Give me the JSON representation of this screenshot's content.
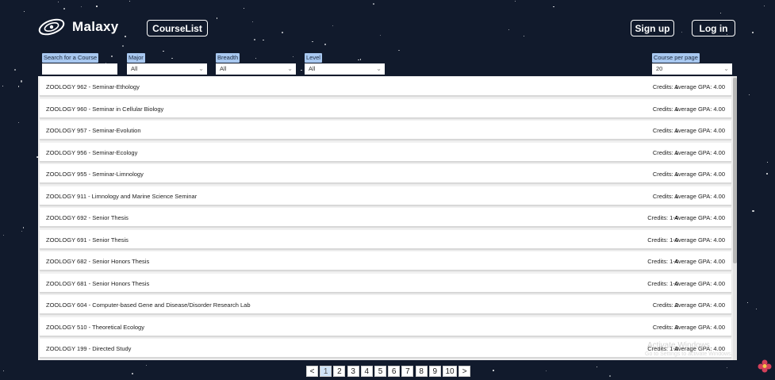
{
  "app": {
    "name": "Malaxy"
  },
  "nav": {
    "courselist_label": "CourseList",
    "signup_label": "Sign up",
    "login_label": "Log in"
  },
  "filters": {
    "search": {
      "label": "Search for a Course",
      "value": ""
    },
    "major": {
      "label": "Major",
      "value": "All"
    },
    "breadth": {
      "label": "Breadth",
      "value": "All"
    },
    "level": {
      "label": "Level",
      "value": "All"
    },
    "per_page": {
      "label": "Course per page",
      "value": "20"
    }
  },
  "courses": [
    {
      "title": "ZOOLOGY 962 - Seminar-Ethology",
      "credits": "Credits: 1",
      "gpa": "Average GPA: 4.00"
    },
    {
      "title": "ZOOLOGY 960 - Seminar in Cellular Biology",
      "credits": "Credits: 1",
      "gpa": "Average GPA: 4.00"
    },
    {
      "title": "ZOOLOGY 957 - Seminar-Evolution",
      "credits": "Credits: 1",
      "gpa": "Average GPA: 4.00"
    },
    {
      "title": "ZOOLOGY 956 - Seminar-Ecology",
      "credits": "Credits: 1",
      "gpa": "Average GPA: 4.00"
    },
    {
      "title": "ZOOLOGY 955 - Seminar-Limnology",
      "credits": "Credits: 1",
      "gpa": "Average GPA: 4.00"
    },
    {
      "title": "ZOOLOGY 911 - Limnology and Marine Science Seminar",
      "credits": "Credits: 1",
      "gpa": "Average GPA: 4.00"
    },
    {
      "title": "ZOOLOGY 692 - Senior Thesis",
      "credits": "Credits: 1-4",
      "gpa": "Average GPA: 4.00"
    },
    {
      "title": "ZOOLOGY 691 - Senior Thesis",
      "credits": "Credits: 1-6",
      "gpa": "Average GPA: 4.00"
    },
    {
      "title": "ZOOLOGY 682 - Senior Honors Thesis",
      "credits": "Credits: 1-4",
      "gpa": "Average GPA: 4.00"
    },
    {
      "title": "ZOOLOGY 681 - Senior Honors Thesis",
      "credits": "Credits: 1-6",
      "gpa": "Average GPA: 4.00"
    },
    {
      "title": "ZOOLOGY 604 - Computer-based Gene and Disease/Disorder Research Lab",
      "credits": "Credits: 2",
      "gpa": "Average GPA: 4.00"
    },
    {
      "title": "ZOOLOGY 510 - Theoretical Ecology",
      "credits": "Credits: 3",
      "gpa": "Average GPA: 4.00"
    },
    {
      "title": "ZOOLOGY 199 - Directed Study",
      "credits": "Credits: 1-3",
      "gpa": "Average GPA: 4.00"
    }
  ],
  "pagination": {
    "prev": "<",
    "next": ">",
    "pages": [
      "1",
      "2",
      "3",
      "4",
      "5",
      "6",
      "7",
      "8",
      "9",
      "10"
    ],
    "current": "1"
  },
  "watermark": {
    "title": "Activate Windows",
    "subtitle": "Go to Settings to activate Windows."
  },
  "colors": {
    "background": "#111a2c",
    "label_bg": "#a8c8f0",
    "active_page": "#cfe3f7"
  }
}
